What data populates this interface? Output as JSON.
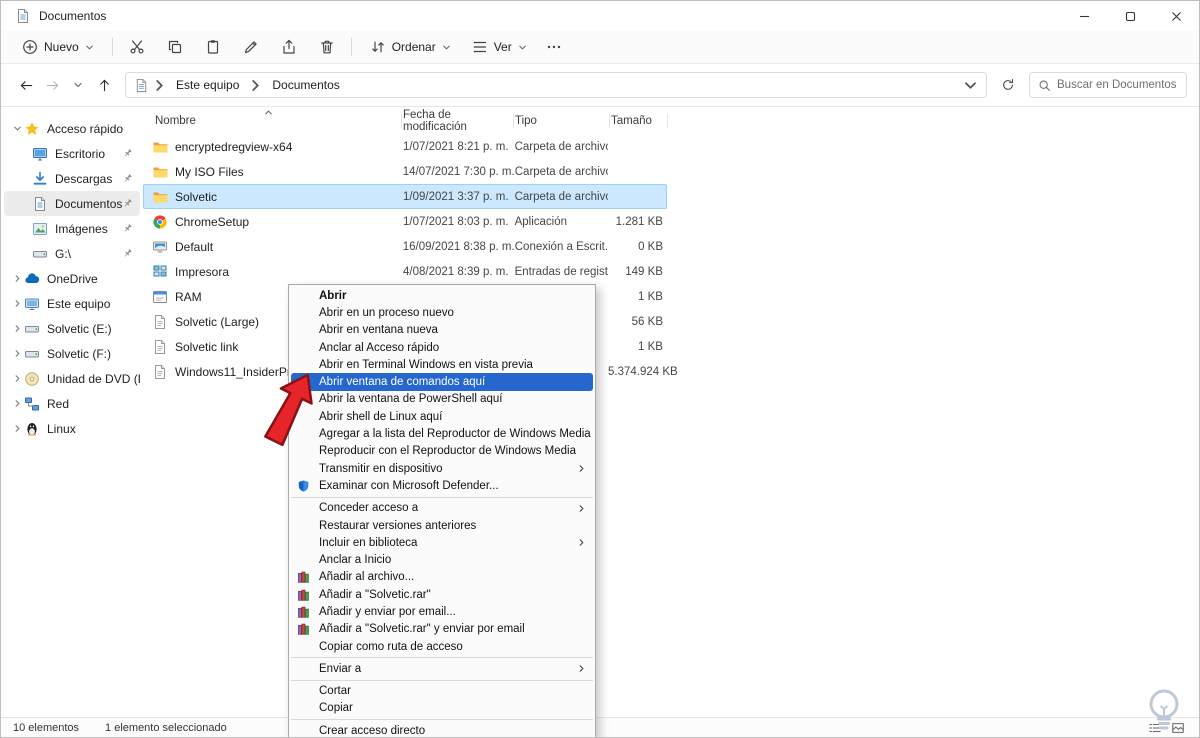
{
  "window": {
    "title": "Documentos"
  },
  "toolbar": {
    "new_label": "Nuevo",
    "action_icons": [
      "cut",
      "copy",
      "paste",
      "rename",
      "share",
      "delete"
    ],
    "sort_label": "Ordenar",
    "view_label": "Ver"
  },
  "address": {
    "crumbs": [
      "Este equipo",
      "Documentos"
    ],
    "search_placeholder": "Buscar en Documentos"
  },
  "sidebar": {
    "items": [
      {
        "label": "Acceso rápido",
        "icon": "star",
        "chevron": "down",
        "level": 0
      },
      {
        "label": "Escritorio",
        "icon": "desktop",
        "pinned": true,
        "level": 1
      },
      {
        "label": "Descargas",
        "icon": "downloads",
        "pinned": true,
        "level": 1
      },
      {
        "label": "Documentos",
        "icon": "documents",
        "pinned": true,
        "level": 1,
        "selected": true
      },
      {
        "label": "Imágenes",
        "icon": "pictures",
        "pinned": true,
        "level": 1
      },
      {
        "label": "G:\\",
        "icon": "drive",
        "pinned": true,
        "level": 1
      },
      {
        "label": "OneDrive",
        "icon": "cloud",
        "chevron": "right",
        "level": 0
      },
      {
        "label": "Este equipo",
        "icon": "computer",
        "chevron": "right",
        "level": 0
      },
      {
        "label": "Solvetic (E:)",
        "icon": "drive",
        "chevron": "right",
        "level": 0
      },
      {
        "label": "Solvetic (F:)",
        "icon": "drive",
        "chevron": "right",
        "level": 0
      },
      {
        "label": "Unidad de DVD (D:)",
        "icon": "dvd",
        "chevron": "right",
        "level": 0
      },
      {
        "label": "Red",
        "icon": "network",
        "chevron": "right",
        "level": 0
      },
      {
        "label": "Linux",
        "icon": "linux",
        "chevron": "right",
        "level": 0
      }
    ]
  },
  "files": {
    "columns": {
      "name": "Nombre",
      "date": "Fecha de modificación",
      "type": "Tipo",
      "size": "Tamaño"
    },
    "rows": [
      {
        "name": "encryptedregview-x64",
        "date": "1/07/2021 8:21 p. m.",
        "type": "Carpeta de archivos",
        "size": "",
        "icon": "folder"
      },
      {
        "name": "My ISO Files",
        "date": "14/07/2021 7:30 p. m.",
        "type": "Carpeta de archivos",
        "size": "",
        "icon": "folder"
      },
      {
        "name": "Solvetic",
        "date": "1/09/2021 3:37 p. m.",
        "type": "Carpeta de archivos",
        "size": "",
        "icon": "folder",
        "selected": true
      },
      {
        "name": "ChromeSetup",
        "date": "1/07/2021 8:03 p. m.",
        "type": "Aplicación",
        "size": "1.281 KB",
        "icon": "app-chrome"
      },
      {
        "name": "Default",
        "date": "16/09/2021 8:38 p. m.",
        "type": "Conexión a Escrit...",
        "size": "0 KB",
        "icon": "rdp"
      },
      {
        "name": "Impresora",
        "date": "4/08/2021 8:39 p. m.",
        "type": "Entradas de registro",
        "size": "149 KB",
        "icon": "registry"
      },
      {
        "name": "RAM",
        "date": "",
        "type": "",
        "size": "1 KB",
        "icon": "app-window"
      },
      {
        "name": "Solvetic (Large)",
        "date": "",
        "type": "",
        "size": "56 KB",
        "icon": "file"
      },
      {
        "name": "Solvetic link",
        "date": "",
        "type": "",
        "size": "1 KB",
        "icon": "file"
      },
      {
        "name": "Windows11_InsiderPreview_Cli...",
        "date": "",
        "type": "",
        "size": "5.374.924 KB",
        "icon": "file"
      }
    ]
  },
  "context_menu": {
    "items": [
      {
        "label": "Abrir",
        "bold": true
      },
      {
        "label": "Abrir en un proceso nuevo"
      },
      {
        "label": "Abrir en ventana nueva"
      },
      {
        "label": "Anclar al Acceso rápido"
      },
      {
        "label": "Abrir en Terminal Windows en vista previa"
      },
      {
        "label": "Abrir ventana de comandos aquí",
        "highlighted": true
      },
      {
        "label": "Abrir la ventana de PowerShell aquí"
      },
      {
        "label": "Abrir shell de Linux aquí"
      },
      {
        "label": "Agregar a la lista del Reproductor de Windows Media"
      },
      {
        "label": "Reproducir con el Reproductor de Windows Media"
      },
      {
        "label": "Transmitir en dispositivo",
        "submenu": true
      },
      {
        "label": "Examinar con Microsoft Defender...",
        "icon": "shield"
      },
      {
        "separator": true
      },
      {
        "label": "Conceder acceso a",
        "submenu": true
      },
      {
        "label": "Restaurar versiones anteriores"
      },
      {
        "label": "Incluir en biblioteca",
        "submenu": true
      },
      {
        "label": "Anclar a Inicio"
      },
      {
        "label": "Añadir al archivo...",
        "icon": "winrar"
      },
      {
        "label": "Añadir a \"Solvetic.rar\"",
        "icon": "winrar"
      },
      {
        "label": "Añadir y enviar por email...",
        "icon": "winrar"
      },
      {
        "label": "Añadir a \"Solvetic.rar\" y enviar por email",
        "icon": "winrar"
      },
      {
        "label": "Copiar como ruta de acceso"
      },
      {
        "separator": true
      },
      {
        "label": "Enviar a",
        "submenu": true
      },
      {
        "separator": true
      },
      {
        "label": "Cortar"
      },
      {
        "label": "Copiar"
      },
      {
        "separator": true
      },
      {
        "label": "Crear acceso directo"
      }
    ]
  },
  "status_bar": {
    "items_text": "10 elementos",
    "selected_text": "1 elemento seleccionado"
  },
  "colors": {
    "menu_highlight": "#2567cd",
    "row_selected_bg": "#cbe8ff",
    "row_selected_border": "#99d1f7",
    "arrow_red": "#e6252a"
  }
}
